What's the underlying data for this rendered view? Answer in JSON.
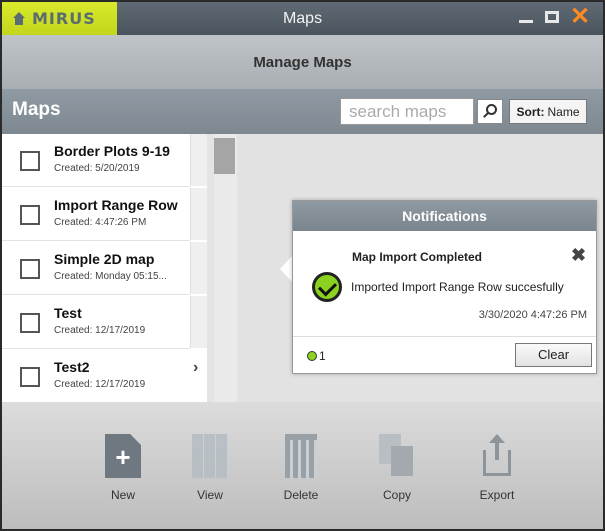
{
  "window": {
    "logo_text": "MIRUS",
    "title": "Maps",
    "subtitle": "Manage Maps"
  },
  "maps_panel": {
    "heading": "Maps",
    "search_placeholder": "search maps",
    "sort_prefix": "Sort:",
    "sort_value": "Name"
  },
  "maps": [
    {
      "name": "Border Plots 9-19",
      "created": "Created: 5/20/2019"
    },
    {
      "name": "Import Range Row",
      "created": "Created: 4:47:26 PM"
    },
    {
      "name": "Simple 2D map",
      "created": "Created: Monday 05:15..."
    },
    {
      "name": "Test",
      "created": "Created: 12/17/2019"
    },
    {
      "name": "Test2",
      "created": "Created: 12/17/2019"
    }
  ],
  "notifications": {
    "header": "Notifications",
    "title": "Map Import Completed",
    "message": "Imported Import Range Row succesfully",
    "timestamp": "3/30/2020 4:47:26 PM",
    "count": "1",
    "clear_label": "Clear"
  },
  "toolbar": {
    "new": "New",
    "view": "View",
    "delete": "Delete",
    "copy": "Copy",
    "export": "Export"
  },
  "colors": {
    "logo_bg": "#cfe026",
    "success_green": "#8bd11f",
    "close_orange": "#ff8a1f"
  }
}
